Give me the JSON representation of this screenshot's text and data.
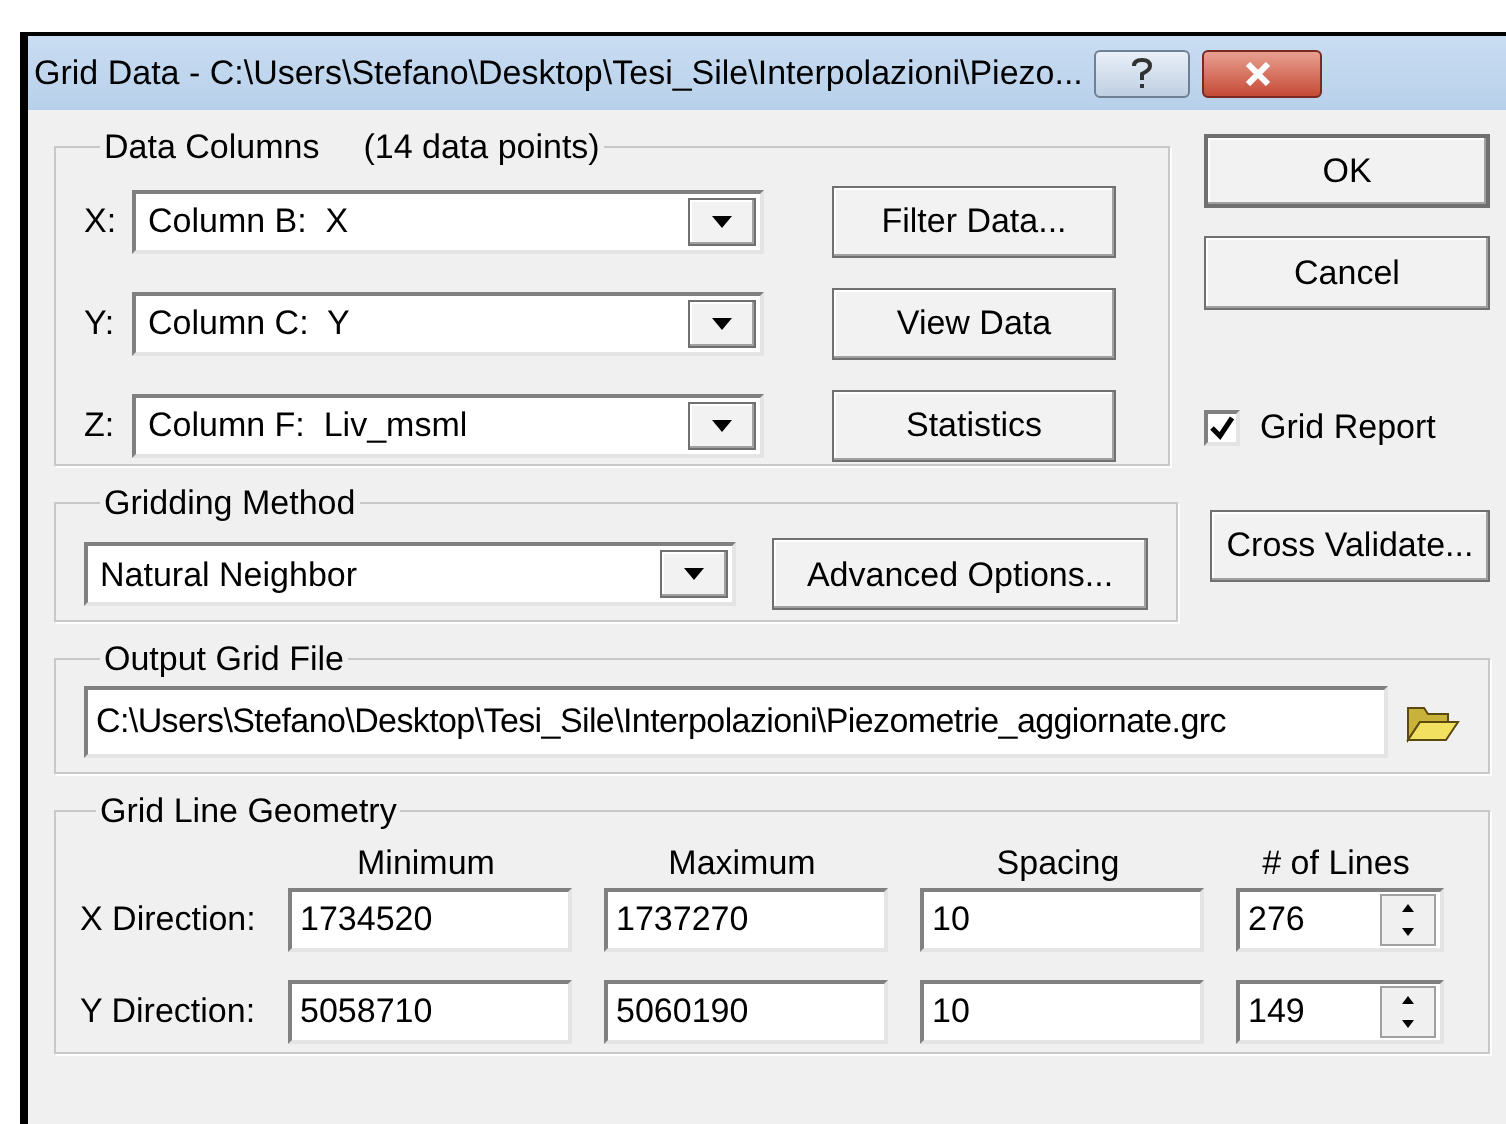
{
  "window": {
    "title": "Grid Data - C:\\Users\\Stefano\\Desktop\\Tesi_Sile\\Interpolazioni\\Piezo..."
  },
  "data_columns": {
    "title": "Data Columns",
    "count": "(14 data points)",
    "fields": [
      {
        "label": "X:",
        "value": "Column B:  X"
      },
      {
        "label": "Y:",
        "value": "Column C:  Y"
      },
      {
        "label": "Z:",
        "value": "Column F:  Liv_msml"
      }
    ],
    "buttons": [
      "Filter Data...",
      "View Data",
      "Statistics"
    ]
  },
  "dialog_buttons": [
    "OK",
    "Cancel"
  ],
  "grid_report": {
    "label": "Grid Report",
    "checked": true
  },
  "gridding_method": {
    "title": "Gridding Method",
    "value": "Natural Neighbor",
    "button": "Advanced Options..."
  },
  "cross_validate": "Cross Validate...",
  "output_grid_file": {
    "title": "Output Grid File",
    "value": "C:\\Users\\Stefano\\Desktop\\Tesi_Sile\\Interpolazioni\\Piezometrie_aggiornate.grc"
  },
  "grid_line_geometry": {
    "title": "Grid Line Geometry",
    "columns": [
      "Minimum",
      "Maximum",
      "Spacing",
      "# of Lines"
    ],
    "rows": [
      {
        "label": "X Direction:",
        "values": [
          "1734520",
          "1737270",
          "10",
          "276"
        ]
      },
      {
        "label": "Y Direction:",
        "values": [
          "5058710",
          "5060190",
          "10",
          "149"
        ]
      }
    ]
  }
}
